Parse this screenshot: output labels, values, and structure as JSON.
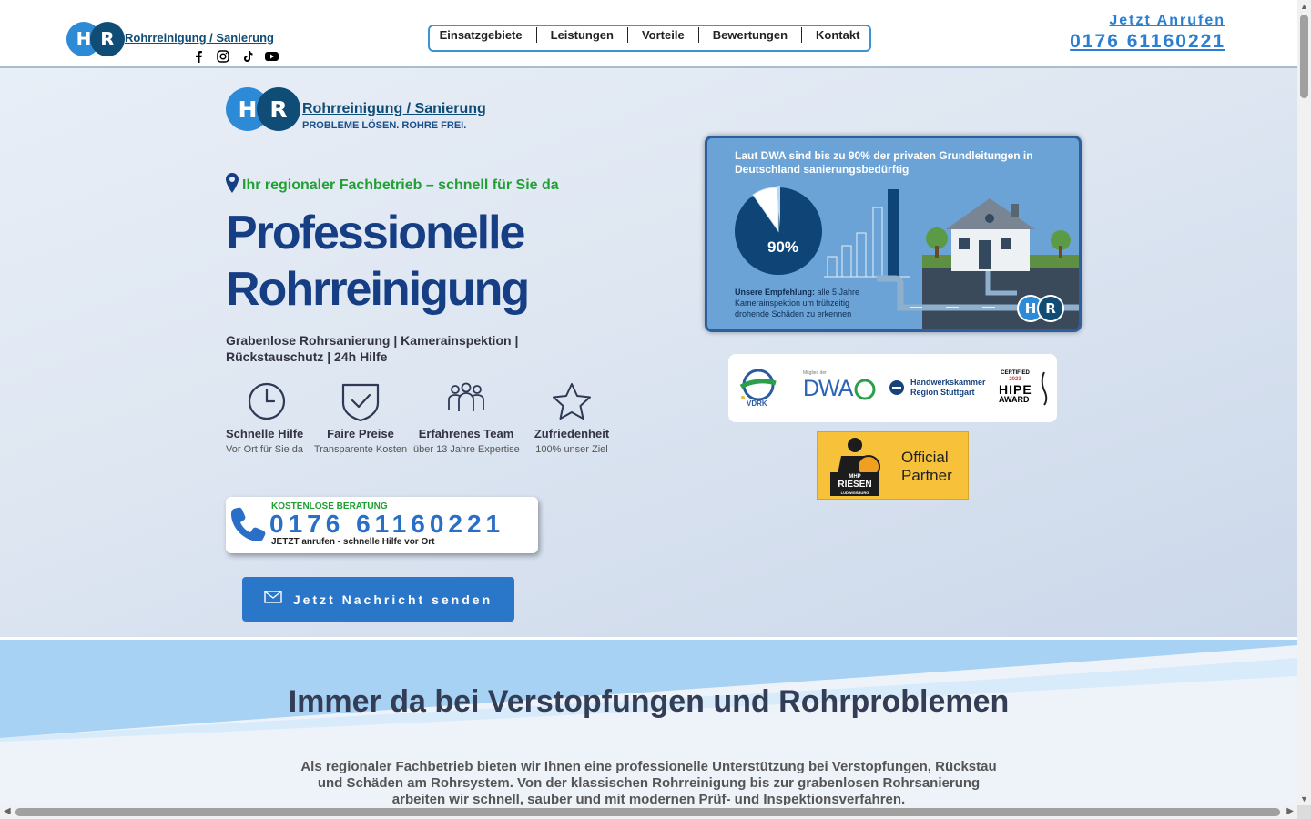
{
  "header": {
    "logo": {
      "h": "H",
      "r": "R",
      "brand": "Rohrreinigung / Sanierung"
    },
    "social": [
      "facebook-icon",
      "instagram-icon",
      "tiktok-icon",
      "youtube-icon"
    ],
    "nav": [
      "Einsatzgebiete",
      "Leistungen",
      "Vorteile",
      "Bewertungen",
      "Kontakt"
    ],
    "call_label": "Jetzt Anrufen",
    "phone": "0176 61160221"
  },
  "hero": {
    "logo": {
      "h": "H",
      "r": "R",
      "brand": "Rohrreinigung / Sanierung",
      "slogan": "PROBLEME LÖSEN. ROHRE FREI."
    },
    "tagline": "Ihr regionaler Fachbetrieb – schnell für Sie da",
    "headline": "Professionelle Rohrreinigung",
    "subline": "Grabenlose Rohrsanierung | Kamerainspektion | Rückstauschutz | 24h Hilfe",
    "features": [
      {
        "title": "Schnelle Hilfe",
        "sub": "Vor Ort für Sie da",
        "icon": "clock-icon"
      },
      {
        "title": "Faire Preise",
        "sub": "Transparente Kosten",
        "icon": "shield-check-icon"
      },
      {
        "title": "Erfahrenes Team",
        "sub": "über 13 Jahre Expertise",
        "icon": "team-icon"
      },
      {
        "title": "Zufriedenheit",
        "sub": "100% unser Ziel",
        "icon": "star-icon"
      }
    ],
    "call_box": {
      "kicker": "KOSTENLOSE BERATUNG",
      "phone": "0176 61160221",
      "cta": "JETZT anrufen - schnelle Hilfe vor Ort"
    },
    "message_button": "Jetzt Nachricht senden",
    "info_card": {
      "title": "Laut DWA sind bis zu 90% der privaten Grundleitungen in Deutschland sanierungsbedürftig",
      "percent": "90%",
      "recommendation_bold": "Unsere Empfehlung:",
      "recommendation": " alle 5 Jahre Kamerainspektion um frühzeitig drohende Schäden zu erkennen"
    },
    "partners": {
      "vdrk": "VDRK",
      "dwa_small": "Mitglied der",
      "dwa": "DWA",
      "hwk_1": "Handwerkskammer",
      "hwk_2": "Region Stuttgart",
      "hipe_1": "CERTIFIED",
      "hipe_2": "2023",
      "hipe_3": "HIPE",
      "hipe_4": "AWARD"
    },
    "official_partner": {
      "line1": "Official",
      "line2": "Partner",
      "badge_1": "MHP",
      "badge_2": "RIESEN",
      "badge_3": "LUDWIGSBURG"
    }
  },
  "section2": {
    "heading": "Immer da bei Verstopfungen und Rohrproblemen",
    "paragraph": "Als regionaler Fachbetrieb bieten wir Ihnen eine professionelle Unterstützung bei Verstopfungen, Rückstau und Schäden am Rohrsystem. Von der klassischen Rohrreinigung bis zur grabenlosen Rohrsanierung arbeiten wir schnell, sauber und mit modernen Prüf- und Inspektionsverfahren."
  },
  "colors": {
    "brand_dark": "#0f4c76",
    "brand_light": "#2d8ad6",
    "headline": "#163e84",
    "accent_green": "#1fa033",
    "phone_blue": "#2a76c8"
  }
}
